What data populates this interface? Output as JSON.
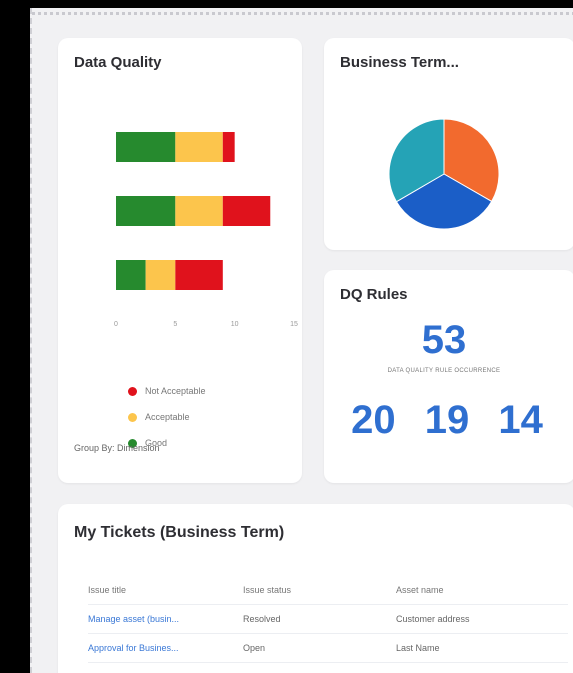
{
  "data_quality": {
    "title": "Data Quality",
    "group_by": "Group By: Dimension",
    "legend": [
      {
        "label": "Not Acceptable",
        "color": "#e0121c"
      },
      {
        "label": "Acceptable",
        "color": "#fcc54c"
      },
      {
        "label": "Good",
        "color": "#268a2e"
      }
    ]
  },
  "chart_data": [
    {
      "type": "bar",
      "orientation": "horizontal",
      "stacked": true,
      "categories": [
        "",
        "",
        ""
      ],
      "series": [
        {
          "name": "Good",
          "values": [
            5,
            5,
            2.5
          ]
        },
        {
          "name": "Acceptable",
          "values": [
            4,
            4,
            2.5
          ]
        },
        {
          "name": "Not Acceptable",
          "values": [
            1,
            4,
            4
          ]
        }
      ],
      "xticks": [
        0,
        5,
        10,
        15
      ],
      "xlim": [
        0,
        15
      ],
      "colors": [
        "#268a2e",
        "#fcc54c",
        "#e0121c"
      ],
      "legend_position": "bottom"
    },
    {
      "type": "pie",
      "values": [
        33.3,
        33.3,
        33.4
      ],
      "colors": [
        "#f26a2e",
        "#1b5ec7",
        "#25a3b6"
      ]
    }
  ],
  "business_terms": {
    "title": "Business Term..."
  },
  "dq_rules": {
    "title": "DQ Rules",
    "total": "53",
    "caption": "DATA QUALITY RULE OCCURRENCE",
    "counts": [
      "20",
      "19",
      "14"
    ],
    "color": "#2f6fd0"
  },
  "tickets": {
    "title": "My Tickets (Business Term)",
    "columns": [
      "Issue title",
      "Issue status",
      "Asset name"
    ],
    "rows": [
      [
        "Manage asset (busin...",
        "Resolved",
        "Customer address"
      ],
      [
        "Approval for Busines...",
        "Open",
        "Last Name"
      ]
    ]
  }
}
